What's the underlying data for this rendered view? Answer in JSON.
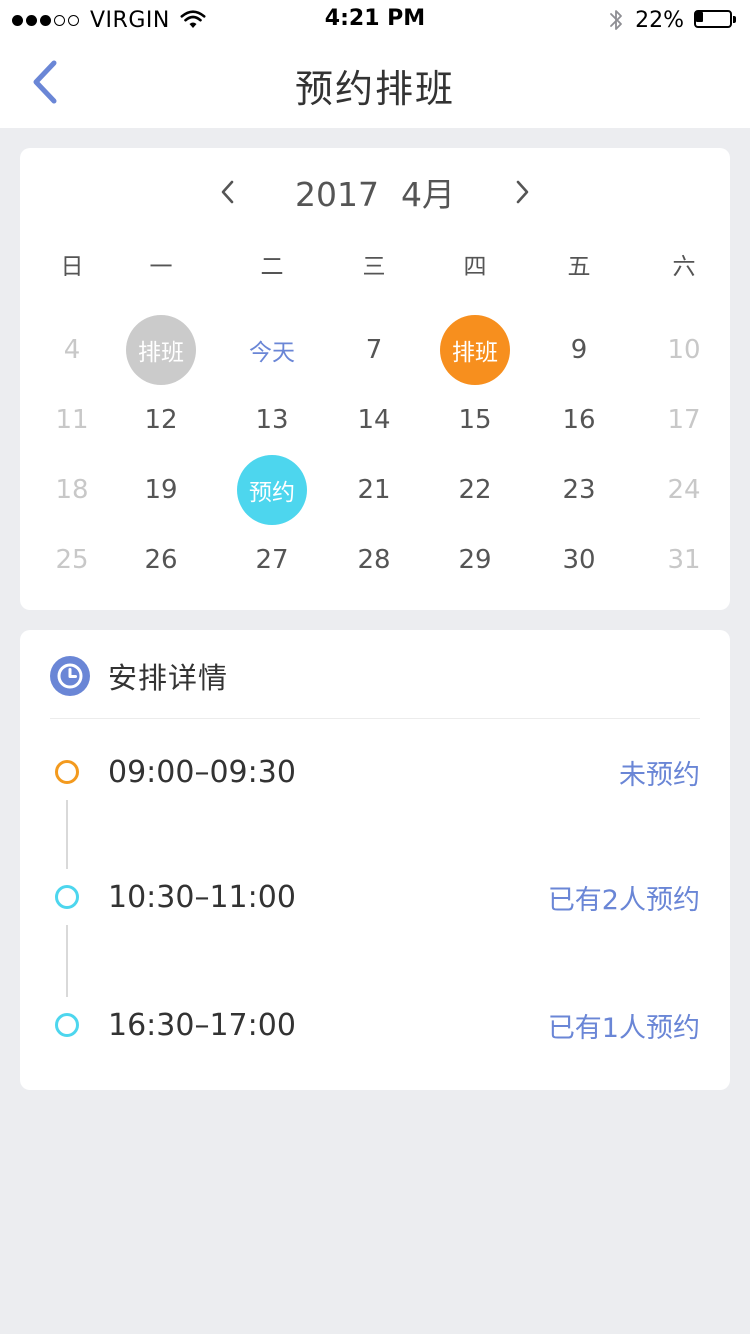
{
  "status_bar": {
    "carrier": "VIRGIN",
    "time": "4:21 PM",
    "battery": "22%",
    "battery_level": 0.22,
    "signal_bars_filled": 3,
    "signal_bars_total": 5
  },
  "nav": {
    "title": "预约排班",
    "back_icon": "chevron-left-icon"
  },
  "calendar": {
    "year": "2017",
    "month": "4月",
    "prev_icon": "chevron-left-icon",
    "next_icon": "chevron-right-icon",
    "weekdays": [
      "日",
      "一",
      "二",
      "三",
      "四",
      "五",
      "六"
    ],
    "weeks": [
      [
        {
          "label": "4",
          "style": "muted"
        },
        {
          "label": "排班",
          "style": "marked",
          "color": "#CBCBCB"
        },
        {
          "label": "今天",
          "style": "today"
        },
        {
          "label": "7",
          "style": "normal"
        },
        {
          "label": "排班",
          "style": "marked",
          "color": "#F78F1E"
        },
        {
          "label": "9",
          "style": "normal"
        },
        {
          "label": "10",
          "style": "muted"
        }
      ],
      [
        {
          "label": "11",
          "style": "muted"
        },
        {
          "label": "12",
          "style": "normal"
        },
        {
          "label": "13",
          "style": "normal"
        },
        {
          "label": "14",
          "style": "normal"
        },
        {
          "label": "15",
          "style": "normal"
        },
        {
          "label": "16",
          "style": "normal"
        },
        {
          "label": "17",
          "style": "muted"
        }
      ],
      [
        {
          "label": "18",
          "style": "muted"
        },
        {
          "label": "19",
          "style": "normal"
        },
        {
          "label": "预约",
          "style": "marked",
          "color": "#4DD6EE"
        },
        {
          "label": "21",
          "style": "normal"
        },
        {
          "label": "22",
          "style": "normal"
        },
        {
          "label": "23",
          "style": "normal"
        },
        {
          "label": "24",
          "style": "muted"
        }
      ],
      [
        {
          "label": "25",
          "style": "muted"
        },
        {
          "label": "26",
          "style": "normal"
        },
        {
          "label": "27",
          "style": "normal"
        },
        {
          "label": "28",
          "style": "normal"
        },
        {
          "label": "29",
          "style": "normal"
        },
        {
          "label": "30",
          "style": "normal"
        },
        {
          "label": "31",
          "style": "muted"
        }
      ]
    ]
  },
  "details": {
    "title": "安排详情",
    "icon": "clock-icon",
    "slots": [
      {
        "time": "09:00–09:30",
        "status": "未预约",
        "dot_color": "#F39A1E"
      },
      {
        "time": "10:30–11:00",
        "status": "已有2人预约",
        "dot_color": "#4DD6EE"
      },
      {
        "time": "16:30–17:00",
        "status": "已有1人预约",
        "dot_color": "#4DD6EE"
      }
    ]
  },
  "colors": {
    "accent": "#6A86D6",
    "scheduled": "#F78F1E",
    "past_scheduled": "#CBCBCB",
    "booked": "#4DD6EE",
    "background": "#ECEDF0"
  }
}
